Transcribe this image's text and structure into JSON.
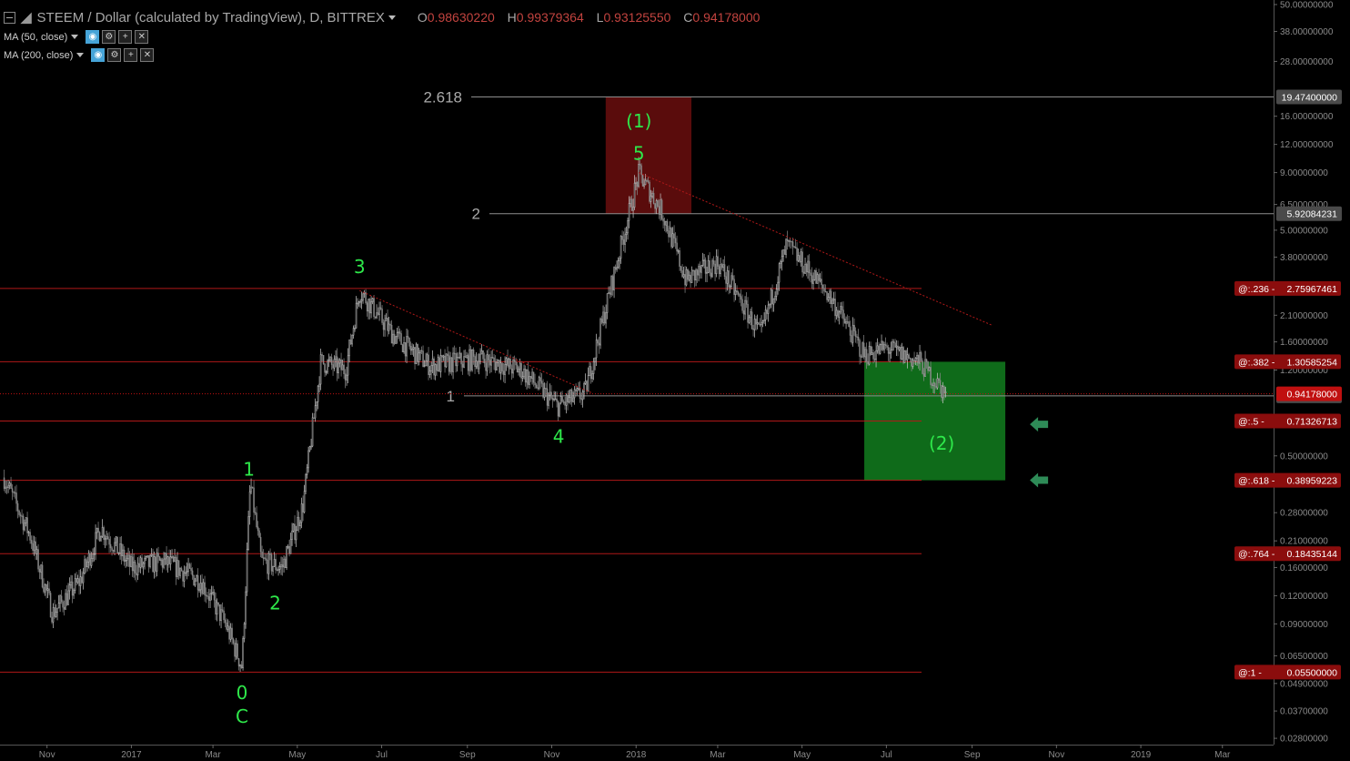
{
  "header": {
    "symbol_title": "STEEM / Dollar (calculated by TradingView), D, BITTREX",
    "ohlc": [
      {
        "key": "O",
        "value": "0.98630220"
      },
      {
        "key": "H",
        "value": "0.99379364"
      },
      {
        "key": "L",
        "value": "0.93125550"
      },
      {
        "key": "C",
        "value": "0.94178000"
      }
    ],
    "indicators": [
      {
        "label": "MA (50, close)"
      },
      {
        "label": "MA (200, close)"
      }
    ]
  },
  "colors": {
    "background": "#000000",
    "up_candle": "#c8c8c8",
    "down_candle": "#8a8a8a",
    "fib_line": "#b01818",
    "trendline": "#b01818",
    "wave_label": "#2ee84a",
    "target_zone": "#0f6b1a",
    "resistance_zone": "#5a0c0c",
    "arrow": "#2e8b57",
    "price_tag_red": "#8b0d0d",
    "last_price_tag": "#c01010"
  },
  "chart_data": {
    "type": "candlestick",
    "scale": "log",
    "ylim": [
      0.027,
      50
    ],
    "x_ticks": [
      "Nov",
      "2017",
      "Mar",
      "May",
      "Jul",
      "Sep",
      "Nov",
      "2018",
      "Mar",
      "May",
      "Jul",
      "Sep",
      "Nov",
      "2019",
      "Mar"
    ],
    "y_ticks": [
      "50.00000000",
      "38.00000000",
      "28.00000000",
      "16.00000000",
      "12.00000000",
      "9.00000000",
      "6.50000000",
      "5.00000000",
      "3.80000000",
      "2.10000000",
      "1.60000000",
      "1.20000000",
      "0.69000000",
      "0.50000000",
      "0.28000000",
      "0.21000000",
      "0.16000000",
      "0.12000000",
      "0.09000000",
      "0.06500000",
      "0.04900000",
      "0.03700000",
      "0.02800000"
    ],
    "price_path": [
      {
        "date": "2016-10-01",
        "price": 0.4
      },
      {
        "date": "2016-10-20",
        "price": 0.22
      },
      {
        "date": "2016-11-05",
        "price": 0.1
      },
      {
        "date": "2016-11-25",
        "price": 0.14
      },
      {
        "date": "2016-12-10",
        "price": 0.24
      },
      {
        "date": "2017-01-01",
        "price": 0.16
      },
      {
        "date": "2017-01-25",
        "price": 0.17
      },
      {
        "date": "2017-02-20",
        "price": 0.14
      },
      {
        "date": "2017-03-10",
        "price": 0.09
      },
      {
        "date": "2017-03-22",
        "price": 0.058
      },
      {
        "date": "2017-03-28",
        "price": 0.38
      },
      {
        "date": "2017-04-05",
        "price": 0.17
      },
      {
        "date": "2017-04-20",
        "price": 0.16
      },
      {
        "date": "2017-05-05",
        "price": 0.3
      },
      {
        "date": "2017-05-18",
        "price": 1.3
      },
      {
        "date": "2017-06-05",
        "price": 1.2
      },
      {
        "date": "2017-06-15",
        "price": 2.7
      },
      {
        "date": "2017-07-10",
        "price": 1.7
      },
      {
        "date": "2017-08-05",
        "price": 1.25
      },
      {
        "date": "2017-09-10",
        "price": 1.35
      },
      {
        "date": "2017-10-10",
        "price": 1.2
      },
      {
        "date": "2017-11-05",
        "price": 0.83
      },
      {
        "date": "2017-11-25",
        "price": 0.95
      },
      {
        "date": "2017-12-15",
        "price": 3.0
      },
      {
        "date": "2018-01-03",
        "price": 8.9
      },
      {
        "date": "2018-01-20",
        "price": 6.0
      },
      {
        "date": "2018-02-06",
        "price": 3.0
      },
      {
        "date": "2018-03-01",
        "price": 3.6
      },
      {
        "date": "2018-04-01",
        "price": 1.7
      },
      {
        "date": "2018-04-20",
        "price": 4.3
      },
      {
        "date": "2018-05-20",
        "price": 2.6
      },
      {
        "date": "2018-06-15",
        "price": 1.4
      },
      {
        "date": "2018-07-01",
        "price": 1.5
      },
      {
        "date": "2018-07-25",
        "price": 1.3
      },
      {
        "date": "2018-08-13",
        "price": 0.94
      }
    ],
    "price_lines": [
      {
        "label": "2.618",
        "value": 19.474,
        "tag": "19.47400000"
      },
      {
        "label": "2",
        "value": 5.92084231,
        "tag": "5.92084231"
      },
      {
        "label": "1",
        "value": 0.922,
        "tag": "0.92200000"
      }
    ],
    "fib_levels": [
      {
        "ratio": "@:.236",
        "value": 2.75967461,
        "tag": "2.75967461"
      },
      {
        "ratio": "@:.382",
        "value": 1.30585254,
        "tag": "1.30585254"
      },
      {
        "ratio": "@:.5",
        "value": 0.71326713,
        "tag": "0.71326713"
      },
      {
        "ratio": "@:.618",
        "value": 0.38959223,
        "tag": "0.38959223"
      },
      {
        "ratio": "@:.764",
        "value": 0.18435144,
        "tag": "0.18435144"
      },
      {
        "ratio": "@:1",
        "value": 0.055,
        "tag": "0.05500000"
      }
    ],
    "last_price": {
      "value": 0.94178,
      "tag": "0.94178000"
    },
    "wave_labels": [
      {
        "text": "0",
        "date": "2017-03-22",
        "price": 0.044
      },
      {
        "text": "C",
        "date": "2017-03-22",
        "price": 0.0345
      },
      {
        "text": "1",
        "date": "2017-03-27",
        "price": 0.43
      },
      {
        "text": "2",
        "date": "2017-04-15",
        "price": 0.11
      },
      {
        "text": "3",
        "date": "2017-06-15",
        "price": 3.4
      },
      {
        "text": "4",
        "date": "2017-11-06",
        "price": 0.6
      },
      {
        "text": "5",
        "date": "2018-01-03",
        "price": 10.8
      },
      {
        "text": "(1)",
        "date": "2018-01-03",
        "price": 15.0
      },
      {
        "text": "(2)",
        "date": "2018-08-10",
        "price": 0.56
      }
    ],
    "zones": [
      {
        "kind": "resistance",
        "start": "2017-12-10",
        "end": "2018-02-10",
        "top": 19.474,
        "bottom": 5.92
      },
      {
        "kind": "target",
        "start": "2018-06-15",
        "end": "2018-09-25",
        "top": 1.30585254,
        "bottom": 0.38959223
      }
    ],
    "trendlines": [
      {
        "from": {
          "date": "2017-06-15",
          "price": 2.7
        },
        "to": {
          "date": "2017-11-30",
          "price": 0.95
        }
      },
      {
        "from": {
          "date": "2018-01-03",
          "price": 9.0
        },
        "to": {
          "date": "2018-09-15",
          "price": 1.9
        }
      }
    ],
    "arrows": [
      {
        "date": "2018-10-20",
        "price": 0.69
      },
      {
        "date": "2018-10-20",
        "price": 0.39
      }
    ]
  }
}
